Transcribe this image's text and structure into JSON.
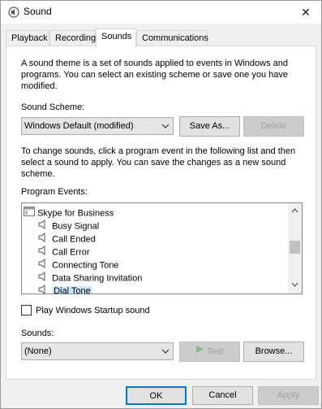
{
  "window": {
    "title": "Sound",
    "icon": "speaker-icon",
    "close_glyph": "✕"
  },
  "tabs": [
    {
      "label": "Playback",
      "active": false
    },
    {
      "label": "Recording",
      "active": false
    },
    {
      "label": "Sounds",
      "active": true
    },
    {
      "label": "Communications",
      "active": false
    }
  ],
  "sounds": {
    "theme_description": "A sound theme is a set of sounds applied to events in Windows and programs.  You can select an existing scheme or save one you have modified.",
    "scheme_label": "Sound Scheme:",
    "scheme_value": "Windows Default (modified)",
    "save_as_label": "Save As...",
    "delete_label": "Delete",
    "change_description": "To change sounds, click a program event in the following list and then select a sound to apply.  You can save the changes as a new sound scheme.",
    "program_events_label": "Program Events:",
    "events": [
      {
        "label": "Skype for Business",
        "type": "group",
        "selected": false
      },
      {
        "label": "Busy Signal",
        "type": "event",
        "selected": false
      },
      {
        "label": "Call Ended",
        "type": "event",
        "selected": false
      },
      {
        "label": "Call Error",
        "type": "event",
        "selected": false
      },
      {
        "label": "Connecting Tone",
        "type": "event",
        "selected": false
      },
      {
        "label": "Data Sharing Invitation",
        "type": "event",
        "selected": false
      },
      {
        "label": "Dial Tone",
        "type": "event",
        "selected": true
      }
    ],
    "startup_checkbox_label": "Play Windows Startup sound",
    "startup_checked": false,
    "sounds_label": "Sounds:",
    "sound_value": "(None)",
    "test_label": "Test",
    "browse_label": "Browse..."
  },
  "footer": {
    "ok_label": "OK",
    "cancel_label": "Cancel",
    "apply_label": "Apply"
  },
  "colors": {
    "accent": "#0078d7",
    "selection": "#cce8ff",
    "disabled_text": "#a0a0a0",
    "test_play": "#7fbf7f"
  }
}
